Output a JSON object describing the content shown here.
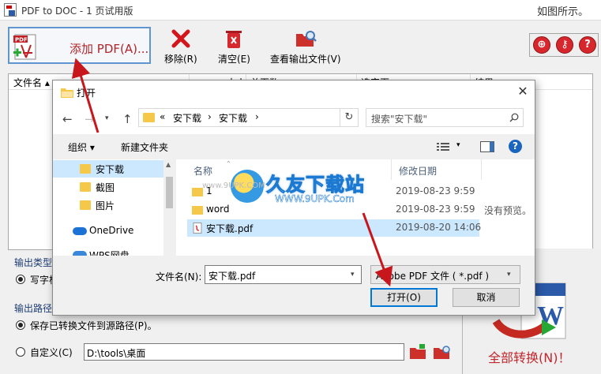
{
  "app": {
    "title": "PDF to DOC - 1 页试用版",
    "title_right": "如图所示。",
    "toolbar": {
      "add_pdf_label": "添加 PDF(A)...",
      "remove_label": "移除(R)",
      "clear_label": "清空(E)",
      "view_output_label": "查看输出文件(V)"
    },
    "round_buttons": [
      {
        "icon": "globe-icon",
        "glyph": "⊕"
      },
      {
        "icon": "key-icon",
        "glyph": "⚷"
      },
      {
        "icon": "help-icon",
        "glyph": "?"
      }
    ],
    "filelist": {
      "col_filename": "文件名",
      "col_2": "大小",
      "col_3": "总页数",
      "col_4": "选定页",
      "col_5": "结果"
    },
    "output_type": {
      "title": "输出类型",
      "option_1": "写字板"
    },
    "output_path": {
      "title": "输出路径",
      "option_source": "保存已转换文件到源路径(P)。",
      "option_custom": "自定义(C)",
      "custom_path": "D:\\tools\\桌面"
    },
    "convert_all_label": "全部转换(N)！"
  },
  "dialog": {
    "title": "打开",
    "address": {
      "chevrons": "«",
      "part1": "安下载",
      "sep": "›",
      "part2": "安下载",
      "sep2": "›"
    },
    "search_placeholder": "搜索\"安下载\"",
    "commands": {
      "organize": "组织 ▾",
      "new_folder": "新建文件夹"
    },
    "nav_items": [
      {
        "label": "安下载",
        "selected": true
      },
      {
        "label": "截图",
        "selected": false
      },
      {
        "label": "图片",
        "selected": false
      }
    ],
    "onedrive_label": "OneDrive",
    "nav_bottom_label": "WPS网盘",
    "file_columns": {
      "name": "名称",
      "modified": "修改日期"
    },
    "files": [
      {
        "name": "1",
        "date": "2019-08-23 9:59",
        "type": "folder",
        "selected": false
      },
      {
        "name": "word",
        "date": "2019-08-23 9:59",
        "type": "folder",
        "selected": false
      },
      {
        "name": "安下载.pdf",
        "date": "2019-08-20 14:06",
        "type": "pdf",
        "selected": true
      }
    ],
    "preview_text": "没有预览。",
    "filename_label": "文件名(N):",
    "filename_value": "安下载.pdf",
    "filetype_value": "Adobe PDF 文件 ( *.pdf )",
    "open_button": "打开(O)",
    "cancel_button": "取消"
  },
  "watermark": {
    "title": "久友下载站",
    "url": "WWW.9UPK.Com",
    "url_small": "www.9UPK.COM"
  },
  "colors": {
    "accent_red": "#c1272d",
    "selection_blue": "#cce8ff",
    "focus_blue": "#0078d7",
    "folder_yellow": "#f6c84a"
  }
}
